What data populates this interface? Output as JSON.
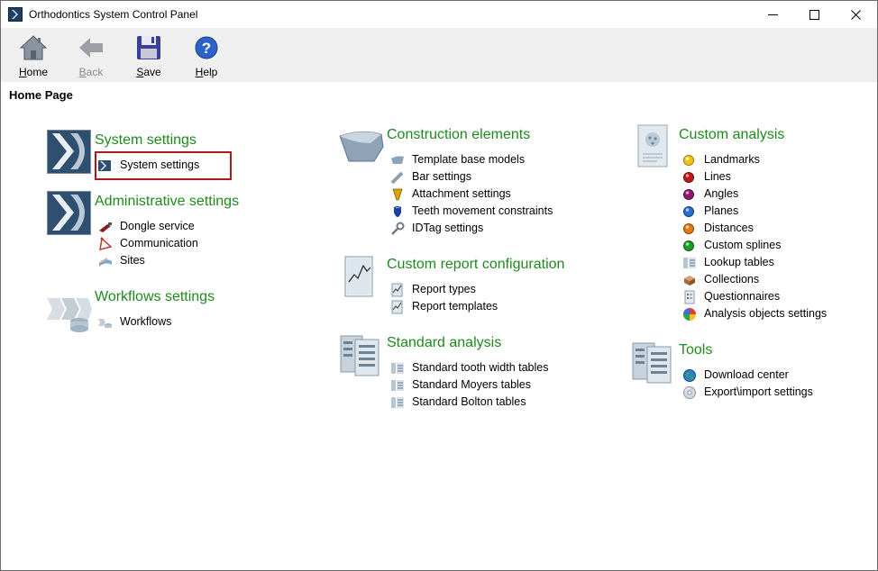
{
  "window": {
    "title": "Orthodontics System Control Panel"
  },
  "toolbar": {
    "home": {
      "label_ul": "H",
      "label_rest": "ome"
    },
    "back": {
      "label_ul": "B",
      "label_rest": "ack"
    },
    "save": {
      "label_ul": "S",
      "label_rest": "ave"
    },
    "help": {
      "label_ul": "H",
      "label_rest": "elp"
    }
  },
  "page_title": "Home Page",
  "system_settings": {
    "title": "System settings",
    "items": [
      {
        "label": "System settings",
        "icon": "system-settings-icon"
      }
    ]
  },
  "administrative_settings": {
    "title": "Administrative settings",
    "items": [
      {
        "label": "Dongle service",
        "icon": "dongle-icon"
      },
      {
        "label": "Communication",
        "icon": "communication-icon"
      },
      {
        "label": "Sites",
        "icon": "sites-icon"
      }
    ]
  },
  "workflows_settings": {
    "title": "Workflows settings",
    "items": [
      {
        "label": "Workflows",
        "icon": "workflows-icon"
      }
    ]
  },
  "construction_elements": {
    "title": "Construction elements",
    "items": [
      {
        "label": "Template base models",
        "icon": "template-base-icon"
      },
      {
        "label": "Bar settings",
        "icon": "bar-icon"
      },
      {
        "label": "Attachment settings",
        "icon": "attachment-icon"
      },
      {
        "label": "Teeth movement constraints",
        "icon": "tooth-icon"
      },
      {
        "label": "IDTag settings",
        "icon": "wrench-icon"
      }
    ]
  },
  "custom_report": {
    "title": "Custom report configuration",
    "items": [
      {
        "label": "Report types",
        "icon": "report-icon"
      },
      {
        "label": "Report templates",
        "icon": "report-icon"
      }
    ]
  },
  "standard_analysis": {
    "title": "Standard analysis",
    "items": [
      {
        "label": "Standard tooth width tables",
        "icon": "table-icon"
      },
      {
        "label": "Standard Moyers tables",
        "icon": "table-icon"
      },
      {
        "label": "Standard Bolton tables",
        "icon": "table-icon"
      }
    ]
  },
  "custom_analysis": {
    "title": "Custom analysis",
    "items": [
      {
        "label": "Landmarks",
        "icon": "yellow-dot-icon"
      },
      {
        "label": "Lines",
        "icon": "red-dot-icon"
      },
      {
        "label": "Angles",
        "icon": "purple-dot-icon"
      },
      {
        "label": "Planes",
        "icon": "blue-dot-icon"
      },
      {
        "label": "Distances",
        "icon": "orange-dot-icon"
      },
      {
        "label": "Custom splines",
        "icon": "green-dot-icon"
      },
      {
        "label": "Lookup tables",
        "icon": "table-icon"
      },
      {
        "label": "Collections",
        "icon": "collections-icon"
      },
      {
        "label": "Questionnaires",
        "icon": "questionnaire-icon"
      },
      {
        "label": "Analysis objects settings",
        "icon": "color-wheel-icon"
      }
    ]
  },
  "tools": {
    "title": "Tools",
    "items": [
      {
        "label": "Download center",
        "icon": "globe-icon"
      },
      {
        "label": "Export\\import settings",
        "icon": "disc-icon"
      }
    ]
  },
  "colors": {
    "section_title": "#1e8a1e",
    "highlight_border": "#b01818",
    "toolbar_bg": "#efefef"
  }
}
